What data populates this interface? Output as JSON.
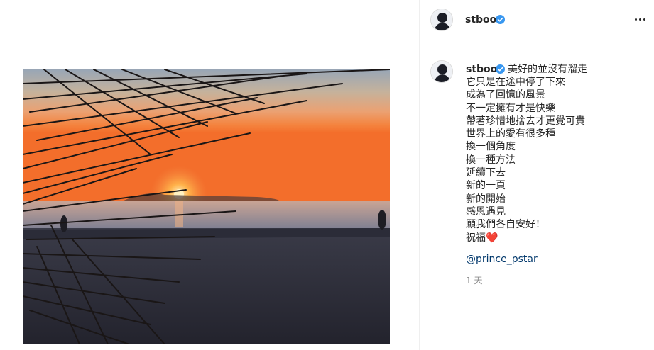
{
  "post": {
    "username": "stboo",
    "verified": true,
    "caption_lines": [
      "美好的並沒有溜走",
      "它只是在途中停了下來",
      "成為了回憶的風景",
      "不一定擁有才是快樂",
      "帶著珍惜地捨去才更覺可貴",
      "世界上的愛有很多種",
      "換一個角度",
      "換一種方法",
      "延續下去",
      "新的一頁",
      "新的開始",
      "感恩遇見",
      "願我們各自安好！",
      "祝福"
    ],
    "caption_emoji": "❤️",
    "mention": "@prince_pstar",
    "timestamp": "1 天"
  },
  "colors": {
    "verified_badge": "#3897f0",
    "mention_link": "#00376b",
    "timestamp": "#8e8e8e",
    "divider": "#efefef"
  },
  "icons": {
    "more": "more-options-icon",
    "verified": "verified-badge-icon"
  }
}
